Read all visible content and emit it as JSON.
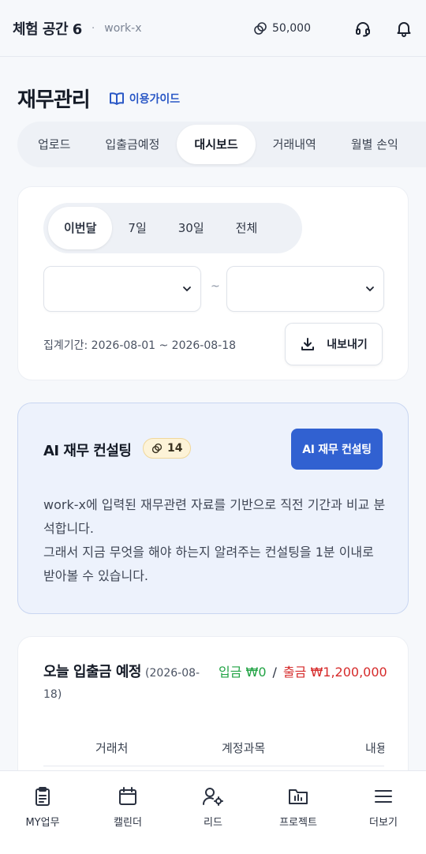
{
  "header": {
    "workspace": "체험 공간 6",
    "separator": "·",
    "sub": "work-x",
    "coins": "50,000",
    "icons": [
      "coin-icon",
      "headset-icon",
      "bell-icon"
    ]
  },
  "page": {
    "title": "재무관리",
    "guide_label": "이용가이드"
  },
  "tabs": [
    {
      "label": "업로드",
      "active": false
    },
    {
      "label": "입출금예정",
      "active": false
    },
    {
      "label": "대시보드",
      "active": true
    },
    {
      "label": "거래내역",
      "active": false
    },
    {
      "label": "월별 손익",
      "active": false
    }
  ],
  "filter": {
    "periods": [
      {
        "label": "이번달",
        "active": true
      },
      {
        "label": "7일",
        "active": false
      },
      {
        "label": "30일",
        "active": false
      },
      {
        "label": "전체",
        "active": false
      }
    ],
    "start_value": "",
    "end_value": "",
    "tilde": "~",
    "period_text": "집계기간: 2026-08-01 ~ 2026-08-18",
    "export_label": "내보내기"
  },
  "ai": {
    "title": "AI 재무 컨설팅",
    "badge_count": "14",
    "button_label": "AI 재무 컨설팅",
    "description_1": "work-x에 입력된 재무관련 자료를 기반으로 직전 기간과 비교 분석합니다.",
    "description_2": "그래서 지금 무엇을 해야 하는지 알려주는 컨설팅을 1분 이내로 받아볼 수 있습니다."
  },
  "today": {
    "title": "오늘 입출금 예정",
    "date": "(2026-08-18)",
    "in_text": "입금 ₩0",
    "slash": "/",
    "out_text": "출금 ₩1,200,000",
    "columns": [
      "거래처",
      "계정과목",
      "내용"
    ]
  },
  "bottom_nav": [
    {
      "label": "MY업무",
      "icon": "clipboard-icon"
    },
    {
      "label": "캘린더",
      "icon": "calendar-icon"
    },
    {
      "label": "리드",
      "icon": "user-gear-icon"
    },
    {
      "label": "프로젝트",
      "icon": "folder-chart-icon"
    },
    {
      "label": "더보기",
      "icon": "menu-icon"
    }
  ],
  "colors": {
    "accent": "#3161d1",
    "income": "#21a344",
    "expense": "#d62b2b",
    "guide": "#2a58c6"
  }
}
